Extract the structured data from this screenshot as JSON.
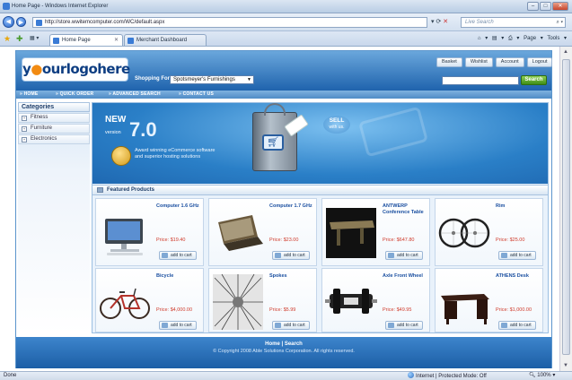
{
  "browser": {
    "title": "Home Page - Windows Internet Explorer",
    "url": "http://store.wwitemcomputer.com/WC/default.aspx",
    "search_placeholder": "Live Search",
    "tabs": [
      {
        "label": "Home Page",
        "active": true
      },
      {
        "label": "Merchant Dashboard",
        "active": false
      }
    ],
    "commands": "Page ▾  Tools ▾",
    "status_left": "Done",
    "status_zone": "Internet | Protected Mode: Off",
    "status_zoom": "100%"
  },
  "site": {
    "logo_part1": "y",
    "logo_part2": "ourlogohere",
    "header_buttons": [
      "Basket",
      "Wishlist",
      "Account",
      "Logout"
    ],
    "shop_for_label": "Shopping For:",
    "shop_for_value": "Spotsmeyer's Furnishings",
    "search_button": "Search",
    "nav": [
      "» HOME",
      "» QUICK ORDER",
      "» ADVANCED SEARCH",
      "» CONTACT US"
    ],
    "categories_title": "Categories",
    "categories": [
      "Fitness",
      "Furniture",
      "Electronics"
    ],
    "banner": {
      "new": "NEW",
      "version_word": "version",
      "version_number": "7.0",
      "award_text": "Award winning eCommerce software and superior hosting solutions",
      "sell_1": "SELL",
      "sell_2": "with us."
    },
    "featured_title": "Featured Products",
    "add_to_cart": "add to cart",
    "products": [
      {
        "name": "Computer 1.6 GHz",
        "price": "Price: $19.40",
        "icon": "monitor-image"
      },
      {
        "name": "Computer 1.7 GHz",
        "price": "Price: $23.00",
        "icon": "laptop-image"
      },
      {
        "name": "ANTWERP Conference Table",
        "price": "Price: $647.80",
        "icon": "table-image"
      },
      {
        "name": "Rim",
        "price": "Price: $25.00",
        "icon": "wheels-image"
      },
      {
        "name": "Bicycle",
        "price": "Price: $4,000.00",
        "icon": "bicycle-image"
      },
      {
        "name": "Spokes",
        "price": "Price: $5.99",
        "icon": "spokes-image"
      },
      {
        "name": "Axle Front Wheel",
        "price": "Price: $49.95",
        "icon": "hub-image"
      },
      {
        "name": "ATHENS Desk",
        "price": "Price: $1,000.00",
        "icon": "desk-image"
      }
    ],
    "footer_links": "Home | Search",
    "copyright": "© Copyright 2008 Able Solutions Corporation. All rights reserved."
  }
}
